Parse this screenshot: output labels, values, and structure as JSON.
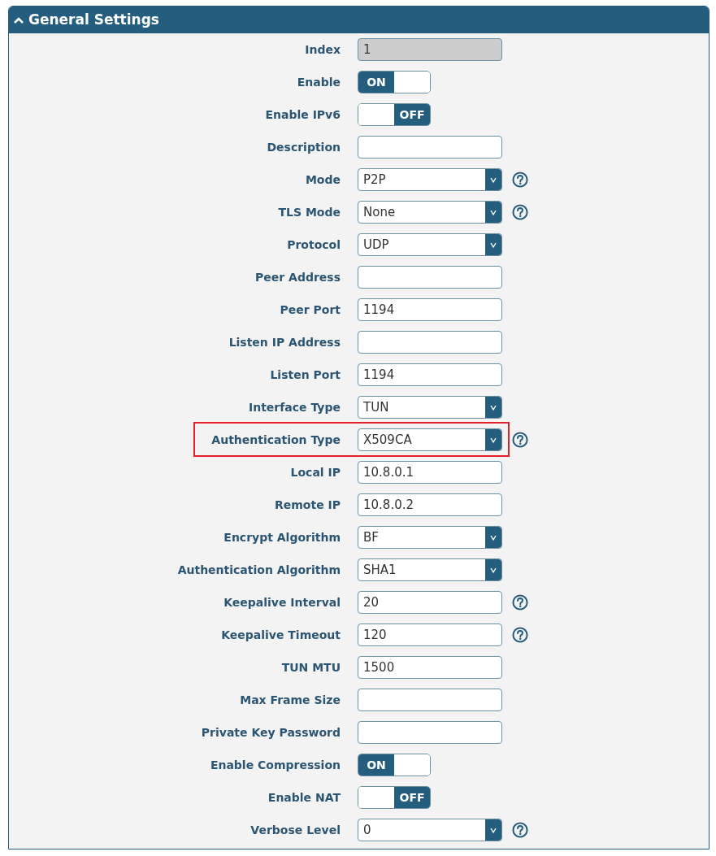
{
  "panel": {
    "title": "General Settings",
    "expanded": true
  },
  "rows": [
    {
      "label": "Index",
      "kind": "text",
      "value": "1",
      "disabled": true,
      "help": false,
      "highlighted": false
    },
    {
      "label": "Enable",
      "kind": "toggle",
      "on": true,
      "switch_text": "ON",
      "help": false,
      "highlighted": false
    },
    {
      "label": "Enable IPv6",
      "kind": "toggle",
      "on": false,
      "switch_text": "OFF",
      "help": false,
      "highlighted": false
    },
    {
      "label": "Description",
      "kind": "text",
      "disabled": false,
      "help": false,
      "highlighted": false
    },
    {
      "label": "Mode",
      "kind": "select",
      "value": "P2P",
      "disabled": false,
      "help": true,
      "highlighted": false
    },
    {
      "label": "TLS Mode",
      "kind": "select",
      "value": "None",
      "disabled": false,
      "help": true,
      "highlighted": false
    },
    {
      "label": "Protocol",
      "kind": "select",
      "value": "UDP",
      "disabled": false,
      "help": false,
      "highlighted": false
    },
    {
      "label": "Peer Address",
      "kind": "text",
      "disabled": false,
      "help": false,
      "highlighted": false
    },
    {
      "label": "Peer Port",
      "kind": "text",
      "value": "1194",
      "disabled": false,
      "help": false,
      "highlighted": false
    },
    {
      "label": "Listen IP Address",
      "kind": "text",
      "disabled": false,
      "help": false,
      "highlighted": false
    },
    {
      "label": "Listen Port",
      "kind": "text",
      "value": "1194",
      "disabled": false,
      "help": false,
      "highlighted": false
    },
    {
      "label": "Interface Type",
      "kind": "select",
      "value": "TUN",
      "disabled": false,
      "help": false,
      "highlighted": false
    },
    {
      "label": "Authentication Type",
      "kind": "select",
      "value": "X509CA",
      "disabled": false,
      "help": true,
      "highlighted": true
    },
    {
      "label": "Local IP",
      "kind": "text",
      "value": "10.8.0.1",
      "disabled": false,
      "help": false,
      "highlighted": false
    },
    {
      "label": "Remote IP",
      "kind": "text",
      "value": "10.8.0.2",
      "disabled": false,
      "help": false,
      "highlighted": false
    },
    {
      "label": "Encrypt Algorithm",
      "kind": "select",
      "value": "BF",
      "disabled": false,
      "help": false,
      "highlighted": false
    },
    {
      "label": "Authentication Algorithm",
      "kind": "select",
      "value": "SHA1",
      "disabled": false,
      "help": false,
      "highlighted": false
    },
    {
      "label": "Keepalive Interval",
      "kind": "text",
      "value": "20",
      "disabled": false,
      "help": true,
      "highlighted": false
    },
    {
      "label": "Keepalive Timeout",
      "kind": "text",
      "value": "120",
      "disabled": false,
      "help": true,
      "highlighted": false
    },
    {
      "label": "TUN MTU",
      "kind": "text",
      "value": "1500",
      "disabled": false,
      "help": false,
      "highlighted": false
    },
    {
      "label": "Max Frame Size",
      "kind": "text",
      "disabled": false,
      "help": false,
      "highlighted": false
    },
    {
      "label": "Private Key Password",
      "kind": "text",
      "disabled": false,
      "help": false,
      "highlighted": false
    },
    {
      "label": "Enable Compression",
      "kind": "toggle",
      "on": true,
      "switch_text": "ON",
      "help": false,
      "highlighted": false
    },
    {
      "label": "Enable NAT",
      "kind": "toggle",
      "on": false,
      "switch_text": "OFF",
      "help": false,
      "highlighted": false
    },
    {
      "label": "Verbose Level",
      "kind": "select",
      "value": "0",
      "disabled": false,
      "help": true,
      "highlighted": false
    }
  ]
}
